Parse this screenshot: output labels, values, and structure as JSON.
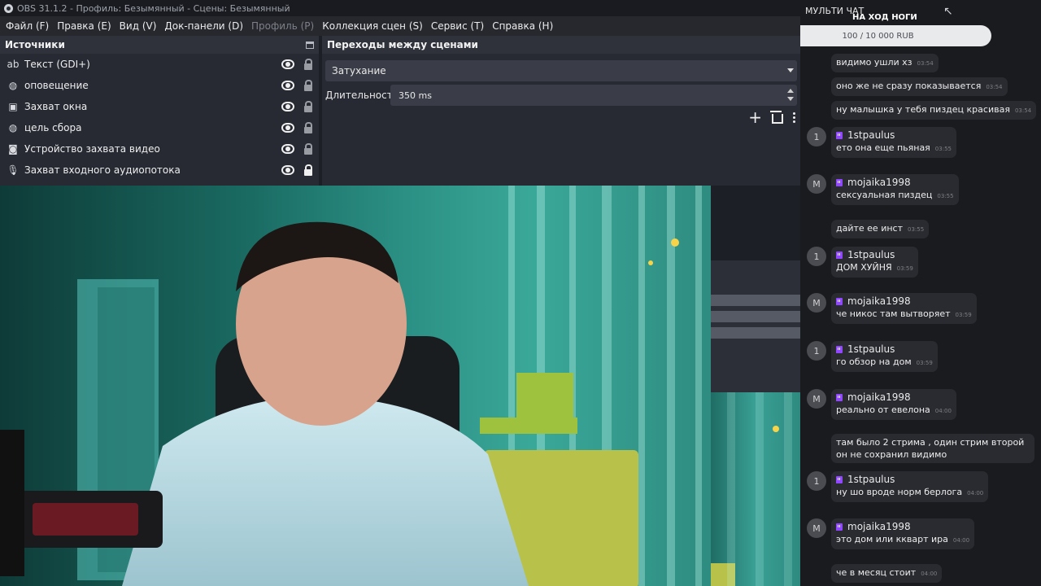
{
  "window": {
    "title": "OBS 31.1.2 - Профиль: Безымянный - Сцены: Безымянный"
  },
  "menu": [
    {
      "label": "Файл (F)",
      "disabled": false
    },
    {
      "label": "Правка (E)",
      "disabled": false
    },
    {
      "label": "Вид (V)",
      "disabled": false
    },
    {
      "label": "Док-панели (D)",
      "disabled": false
    },
    {
      "label": "Профиль (P)",
      "disabled": true
    },
    {
      "label": "Коллекция сцен (S)",
      "disabled": false
    },
    {
      "label": "Сервис (T)",
      "disabled": false
    },
    {
      "label": "Справка (H)",
      "disabled": false
    }
  ],
  "sources": {
    "title": "Источники",
    "items": [
      {
        "label": "Текст (GDI+)",
        "icon": "text-icon",
        "locked": false
      },
      {
        "label": "оповещение",
        "icon": "globe-icon",
        "locked": false
      },
      {
        "label": "Захват окна",
        "icon": "window-icon",
        "locked": false
      },
      {
        "label": "цель сбора",
        "icon": "globe-icon",
        "locked": false
      },
      {
        "label": "Устройство захвата видео",
        "icon": "camera-icon",
        "locked": false
      },
      {
        "label": "Захват входного аудиопотока",
        "icon": "microphone-icon",
        "locked": true
      }
    ]
  },
  "transitions": {
    "title": "Переходы между сценами",
    "selected": "Затухание",
    "duration_label": "Длительность",
    "duration_value": "350 ms"
  },
  "chat": {
    "title": "МУЛЬТИ ЧАТ",
    "subtitle": "НА ХОД НОГИ",
    "goal_text": "100 / 10 000 RUB",
    "messages": [
      {
        "text": "видимо ушли хз",
        "time": "03:54"
      },
      {
        "text": "оно же не сразу показывается",
        "time": "03:54"
      },
      {
        "text": "ну малышка у тебя пиздец красивая",
        "time": "03:54"
      },
      {
        "user": "1stpaulus",
        "avatar": "1",
        "text": "ето она еще пьяная",
        "time": "03:55"
      },
      {
        "user": "mojaika1998",
        "avatar": "M",
        "text": "сексуальная пиздец",
        "time": "03:55"
      },
      {
        "text": "дайте ее инст",
        "time": "03:55"
      },
      {
        "user": "1stpaulus",
        "avatar": "1",
        "text": "ДОМ ХУЙНЯ",
        "time": "03:59"
      },
      {
        "user": "mojaika1998",
        "avatar": "M",
        "text": "че никос там вытворяет",
        "time": "03:59"
      },
      {
        "user": "1stpaulus",
        "avatar": "1",
        "text": "го обзор на дом",
        "time": "03:59"
      },
      {
        "user": "mojaika1998",
        "avatar": "M",
        "text": "реально от евелона",
        "time": "04:00"
      },
      {
        "text": "там было 2 стрима , один стрим второй он не сохранил видимо",
        "time": ""
      },
      {
        "user": "1stpaulus",
        "avatar": "1",
        "text": "ну шо вроде норм берлога",
        "time": "04:00"
      },
      {
        "user": "mojaika1998",
        "avatar": "M",
        "text": "это дом или ккварт ира",
        "time": "04:00"
      },
      {
        "text": "че в месяц стоит",
        "time": "04:00"
      }
    ]
  },
  "colors": {
    "accent": "#36b7a6",
    "twitch": "#9146ff"
  }
}
